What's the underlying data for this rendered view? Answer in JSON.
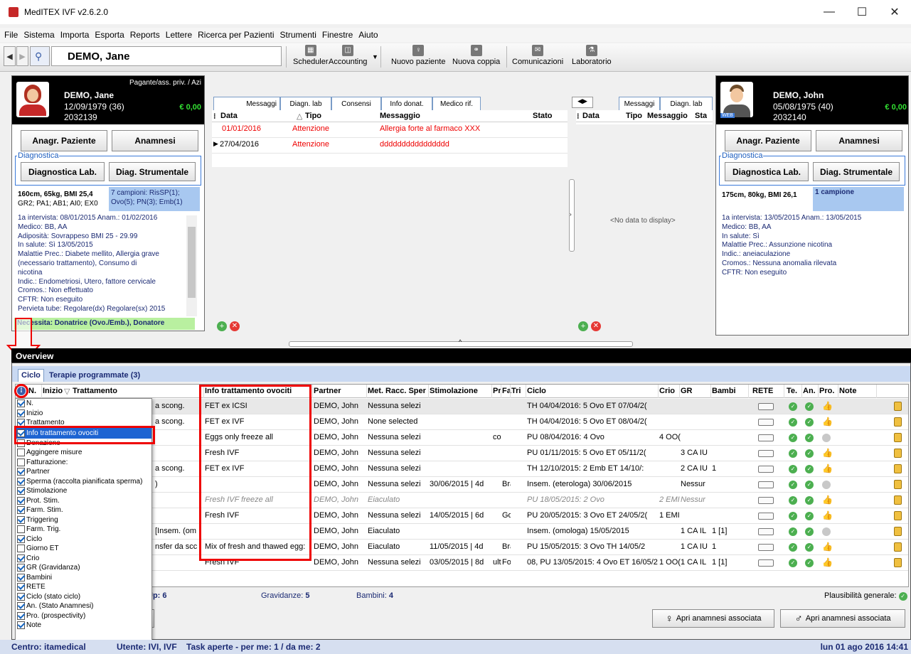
{
  "app": {
    "title": "MedITEX IVF v2.6.2.0"
  },
  "menu": [
    "File",
    "Sistema",
    "Importa",
    "Esporta",
    "Reports",
    "Lettere",
    "Ricerca per Pazienti",
    "Strumenti",
    "Finestre",
    "Aiuto"
  ],
  "toolbar": {
    "patient_name": "DEMO, Jane",
    "scheduler": "Scheduler",
    "accounting": "Accounting",
    "new_patient": "Nuovo paziente",
    "new_couple": "Nuova coppia",
    "communications": "Comunicazioni",
    "laboratory": "Laboratorio"
  },
  "female": {
    "payer": "Pagante/ass. priv. / Azi",
    "name": "DEMO, Jane",
    "dob": "12/09/1979",
    "age": "(36)",
    "id": "2032139",
    "amount": "€ 0,00",
    "btn_anagr": "Anagr. Paziente",
    "btn_anamnesi": "Anamnesi",
    "diag_legend": "Diagnostica",
    "btn_diag_lab": "Diagnostica Lab.",
    "btn_diag_str": "Diag. Strumentale",
    "stats_line1": "160cm, 65kg, BMI 25,4",
    "stats_line2": "GR2; PA1; AB1; AI0; EX0",
    "samples_line1": "7 campioni: RisSP(1);",
    "samples_line2": "Ovo(5); PN(3); Emb(1)",
    "info": [
      "1a intervista: 08/01/2015   Anam.: 01/02/2016",
      "Medico: BB, AA",
      "Adiposità: Sovrappeso BMI 25 - 29.99",
      "In salute: Sì 13/05/2015",
      "Malattie Prec.: Diabete mellito, Allergia grave",
      "(necessario trattamento), Consumo di",
      "nicotina",
      "Indic.: Endometriosi, Utero, fattore cervicale",
      "Cromos.: Non effettuato",
      "CFTR: Non eseguito",
      "Pervieta tube: Regolare(dx) Regolare(sx) 2015"
    ],
    "necessita": "Necessita: Donatrice (Ovo./Emb.), Donatore"
  },
  "messages_left": {
    "tabs": [
      "Messaggi",
      "Diagn. lab",
      "Consensi",
      "Info donat.",
      "Medico rif."
    ],
    "headers": [
      "Data",
      "Tipo",
      "Messaggio",
      "Stato"
    ],
    "rows": [
      {
        "date": "01/01/2016",
        "type": "Attenzione",
        "msg": "Allergia forte al farmaco XXX"
      },
      {
        "date": "27/04/2016",
        "type": "Attenzione",
        "msg": "dddddddddddddddd"
      }
    ]
  },
  "messages_right": {
    "tabs": [
      "Messaggi",
      "Diagn. lab"
    ],
    "headers": [
      "Data",
      "Tipo",
      "Messaggio",
      "Sta"
    ],
    "empty": "<No data to display>"
  },
  "male": {
    "name": "DEMO, John",
    "dob": "05/08/1975",
    "age": "(40)",
    "id": "2032140",
    "amount": "€ 0,00",
    "web": "WEB",
    "btn_anagr": "Anagr. Paziente",
    "btn_anamnesi": "Anamnesi",
    "diag_legend": "Diagnostica",
    "btn_diag_lab": "Diagnostica Lab.",
    "btn_diag_str": "Diag. Strumentale",
    "stats": "175cm, 80kg, BMI 26,1",
    "samples": "1 campione",
    "info": [
      "1a intervista: 13/05/2015   Anam.: 13/05/2015",
      "Medico: BB, AA",
      "In salute: Sì",
      "Malattie Prec.: Assunzione nicotina",
      "Indic.: aneiaculazione",
      "Cromos.: Nessuna anomalia rilevata",
      "CFTR: Non eseguito"
    ]
  },
  "overview": {
    "title": "Overview",
    "tabs": [
      "Ciclo",
      "Terapie programmate (3)"
    ],
    "headers": [
      "N.",
      "Inizio",
      "Trattamento",
      "Info trattamento ovociti",
      "Partner",
      "Met. Racc. Sper",
      "Stimolazione",
      "Pr",
      "Fa",
      "Tri",
      "Ciclo",
      "Crio",
      "GR",
      "Bambi",
      "RETE",
      "Te.",
      "An.",
      "Pro.",
      "Note"
    ],
    "rows": [
      {
        "trat": "a scong.",
        "info": "FET ex ICSI",
        "partner": "DEMO, John",
        "met": "Nessuna selezi",
        "stim": "",
        "pr": "",
        "fa": "",
        "ciclo": "TH 04/04/2016: 5 Ovo    ET 07/04/2(",
        "crio": "",
        "gr": "",
        "bambi": "",
        "pro": "thumb",
        "sel": true,
        "it": false
      },
      {
        "trat": "a scong.",
        "info": "FET ex IVF",
        "partner": "DEMO, John",
        "met": "None selected",
        "stim": "",
        "pr": "",
        "fa": "",
        "ciclo": "TH 04/04/2016: 5 Ovo    ET 08/04/2(",
        "crio": "",
        "gr": "",
        "bambi": "",
        "pro": "thumb",
        "sel": false,
        "it": false
      },
      {
        "trat": "",
        "info": "Eggs only freeze all",
        "partner": "DEMO, John",
        "met": "Nessuna selezi",
        "stim": "",
        "pr": "coi",
        "fa": "",
        "ciclo": "PU 08/04/2016: 4 Ovo",
        "crio": "4 OO(",
        "gr": "",
        "bambi": "",
        "pro": "gray",
        "sel": false,
        "it": false
      },
      {
        "trat": "",
        "info": "Fresh IVF",
        "partner": "DEMO, John",
        "met": "Nessuna selezi",
        "stim": "",
        "pr": "",
        "fa": "",
        "ciclo": "PU 01/11/2015: 5 Ovo    ET 05/11/2(",
        "crio": "",
        "gr": "3 CA IU",
        "bambi": "",
        "pro": "thumb",
        "sel": false,
        "it": false
      },
      {
        "trat": "a scong.",
        "info": "FET ex IVF",
        "partner": "DEMO, John",
        "met": "Nessuna selezi",
        "stim": "",
        "pr": "",
        "fa": "",
        "ciclo": "TH 12/10/2015: 2 Emb    ET 14/10/:",
        "crio": "",
        "gr": "2 CA IU",
        "bambi": "1",
        "pro": "thumb",
        "sel": false,
        "it": false
      },
      {
        "trat": ")",
        "info": "",
        "partner": "DEMO, John",
        "met": "Nessuna selezi",
        "stim": "30/06/2015 | 4d",
        "pr": "",
        "fa": "Bra",
        "ciclo": "Insem. (eterologa) 30/06/2015",
        "crio": "",
        "gr": "Nessur",
        "bambi": "",
        "pro": "gray",
        "sel": false,
        "it": false
      },
      {
        "trat": "",
        "info": "Fresh IVF freeze all",
        "partner": "DEMO, John",
        "met": "Eiaculato",
        "stim": "",
        "pr": "",
        "fa": "",
        "ciclo": "PU 18/05/2015: 2 Ovo",
        "crio": "2 EMI",
        "gr": "Nessur",
        "bambi": "",
        "pro": "thumb",
        "sel": false,
        "it": true
      },
      {
        "trat": "",
        "info": "Fresh IVF",
        "partner": "DEMO, John",
        "met": "Nessuna selezi",
        "stim": "14/05/2015 | 6d",
        "pr": "",
        "fa": "Go",
        "ciclo": "PU 20/05/2015: 3 Ovo    ET 24/05/2(",
        "crio": "1 EMI",
        "gr": "",
        "bambi": "",
        "pro": "thumb",
        "sel": false,
        "it": false
      },
      {
        "trat": "[Insem. (om",
        "info": "",
        "partner": "DEMO, John",
        "met": "Eiaculato",
        "stim": "",
        "pr": "",
        "fa": "",
        "ciclo": "Insem. (omologa) 15/05/2015",
        "crio": "",
        "gr": "1 CA IL",
        "bambi": "1 [1]",
        "pro": "gray",
        "sel": false,
        "it": false
      },
      {
        "trat": "nsfer da scc",
        "info": "Mix of fresh and thawed egg:",
        "partner": "DEMO, John",
        "met": "Eiaculato",
        "stim": "11/05/2015 | 4d",
        "pr": "",
        "fa": "Bra",
        "ciclo": "PU 15/05/2015: 3 Ovo    TH 14/05/2",
        "crio": "",
        "gr": "1 CA IU",
        "bambi": "1",
        "pro": "thumb",
        "sel": false,
        "it": false
      },
      {
        "trat": "",
        "info": "Fresh IVF",
        "partner": "DEMO, John",
        "met": "Nessuna selezi",
        "stim": "03/05/2015 | 8d",
        "pr": "ultı",
        "fa": "Fo",
        "ciclo": "08, PU 13/05/2015: 4 Ovo    ET 16/05/2(",
        "crio": "1 OO(",
        "gr": "1 CA IL",
        "bambi": "1 [1]",
        "pro": "thumb",
        "sel": false,
        "it": false
      }
    ],
    "footer_up": "Up: 6",
    "footer_grav_label": "Gravidanze:",
    "footer_grav": "5",
    "footer_bamb_label": "Bambini:",
    "footer_bamb": "4",
    "plaus": "Plausibilità generale:",
    "copia": "pia",
    "btn_anam_f": "Apri anamnesi associata",
    "btn_anam_m": "Apri anamnesi associata"
  },
  "column_chooser": [
    {
      "label": "N.",
      "on": true
    },
    {
      "label": "Inizio",
      "on": true
    },
    {
      "label": "Trattamento",
      "on": true
    },
    {
      "label": "Info trattamento ovociti",
      "on": true,
      "selected": true
    },
    {
      "label": "Donazione",
      "on": false
    },
    {
      "label": "Aggingere misure",
      "on": false
    },
    {
      "label": "Fatturazione:",
      "on": false
    },
    {
      "label": "Partner",
      "on": true
    },
    {
      "label": "Sperma (raccolta pianificata sperma)",
      "on": true
    },
    {
      "label": "Stimolazione",
      "on": true
    },
    {
      "label": "Prot. Stim.",
      "on": true
    },
    {
      "label": "Farm. Stim.",
      "on": true
    },
    {
      "label": "Triggering",
      "on": true
    },
    {
      "label": "Farm. Trig.",
      "on": false
    },
    {
      "label": "Ciclo",
      "on": true
    },
    {
      "label": "Giorno ET",
      "on": false
    },
    {
      "label": "Crio",
      "on": true
    },
    {
      "label": "GR (Gravidanza)",
      "on": true
    },
    {
      "label": "Bambini",
      "on": true
    },
    {
      "label": "RETE",
      "on": true
    },
    {
      "label": "Ciclo (stato ciclo)",
      "on": true
    },
    {
      "label": "An. (Stato Anamnesi)",
      "on": true
    },
    {
      "label": "Pro. (prospectivity)",
      "on": true
    },
    {
      "label": "Note",
      "on": true
    }
  ],
  "statusbar": {
    "centro": "Centro: itamedical",
    "utente": "Utente: IVI, IVF",
    "tasks": "Task aperte - per me: 1 / da me: 2",
    "date": "lun 01 ago 2016 14:41"
  },
  "colors": {
    "accent_red": "#e00000",
    "panel_black": "#000000",
    "selection_blue": "#1e64d2",
    "header_blue": "#c9d9f2"
  }
}
